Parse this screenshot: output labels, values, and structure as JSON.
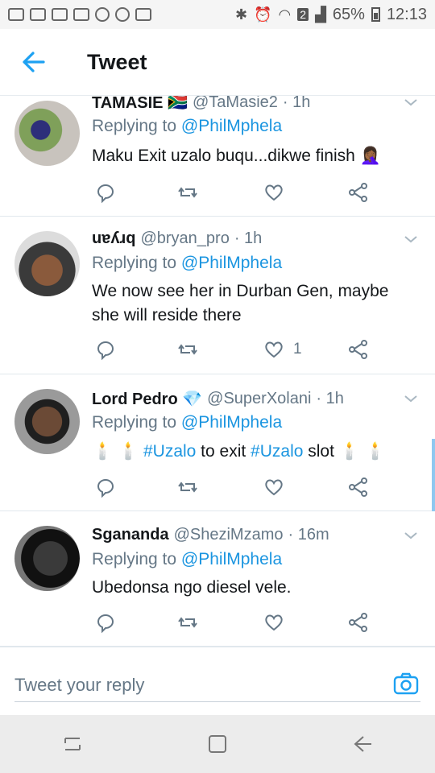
{
  "status_bar": {
    "battery": "65%",
    "time": "12:13",
    "sim_badge": "2"
  },
  "header": {
    "title": "Tweet",
    "back_icon": "back-arrow-icon"
  },
  "tweets": [
    {
      "name": "TAMASIE 🇿🇦",
      "handle": "@TaMasie2",
      "time": "· 1h",
      "replying_prefix": "Replying to ",
      "replying_to": "@PhilMphela",
      "text": "Maku Exit uzalo buqu...dikwe finish 🤦🏾‍♀️",
      "like_count": ""
    },
    {
      "name": "uɐʎɹq",
      "handle": "@bryan_pro",
      "time": "· 1h",
      "replying_prefix": "Replying to ",
      "replying_to": "@PhilMphela",
      "text": "We now see her in Durban Gen, maybe she will reside there",
      "like_count": "1"
    },
    {
      "name": "Lord Pedro 💎",
      "handle": "@SuperXolani",
      "time": "· 1h",
      "replying_prefix": "Replying to ",
      "replying_to": "@PhilMphela",
      "text_parts": [
        "🕯️ 🕯️ ",
        "#Uzalo",
        " to exit ",
        "#Uzalo",
        " slot 🕯️ 🕯️"
      ],
      "like_count": ""
    },
    {
      "name": "Sganand​a",
      "handle": "@SheziMzamo",
      "time": "· 16m",
      "replying_prefix": "Replying to ",
      "replying_to": "@PhilMphela",
      "text": "Ubedonsa ngo diesel vele.",
      "like_count": ""
    }
  ],
  "reply_box": {
    "placeholder": "Tweet your reply"
  },
  "colors": {
    "accent": "#1da1f2",
    "link": "#1b95e0",
    "muted": "#657786",
    "text": "#14171a"
  }
}
